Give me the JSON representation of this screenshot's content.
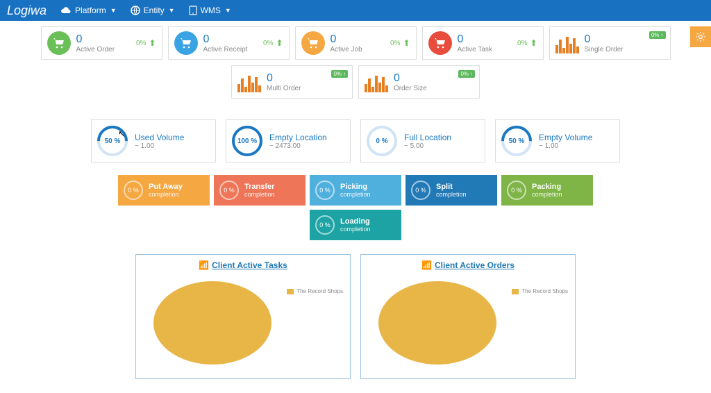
{
  "header": {
    "logo": "Logiwa",
    "nav": [
      {
        "label": "Platform",
        "icon": "cloud-icon"
      },
      {
        "label": "Entity",
        "icon": "globe-icon"
      },
      {
        "label": "WMS",
        "icon": "tablet-icon"
      }
    ]
  },
  "kpi_row1": [
    {
      "value": "0",
      "label": "Active Order",
      "pct": "0%",
      "color": "green",
      "icon": "cart"
    },
    {
      "value": "0",
      "label": "Active Receipt",
      "pct": "0%",
      "color": "blue",
      "icon": "cart"
    },
    {
      "value": "0",
      "label": "Active Job",
      "pct": "0%",
      "color": "orange",
      "icon": "cart"
    },
    {
      "value": "0",
      "label": "Active Task",
      "pct": "0%",
      "color": "red",
      "icon": "cart"
    },
    {
      "value": "0",
      "label": "Single Order",
      "pct": "0%",
      "icon": "bars",
      "badge": true
    }
  ],
  "kpi_row2": [
    {
      "value": "0",
      "label": "Multi Order",
      "pct": "0%",
      "icon": "bars",
      "badge": true
    },
    {
      "value": "0",
      "label": "Order Size",
      "pct": "0%",
      "icon": "bars",
      "badge": true
    }
  ],
  "gauges": [
    {
      "pct": "50 %",
      "title": "Used Volume",
      "sub": "~ 1.00",
      "fill": "half"
    },
    {
      "pct": "100 %",
      "title": "Empty Location",
      "sub": "~ 2473.00",
      "fill": "full"
    },
    {
      "pct": "0 %",
      "title": "Full Location",
      "sub": "~ 5.00",
      "fill": "zero"
    },
    {
      "pct": "50 %",
      "title": "Empty Volume",
      "sub": "~ 1.00",
      "fill": "half"
    }
  ],
  "tiles_row1": [
    {
      "pct": "0 %",
      "title": "Put Away",
      "sub": "completion",
      "cls": "t-orange"
    },
    {
      "pct": "0 %",
      "title": "Transfer",
      "sub": "completion",
      "cls": "t-red"
    },
    {
      "pct": "0 %",
      "title": "Picking",
      "sub": "completion",
      "cls": "t-lblue"
    },
    {
      "pct": "0 %",
      "title": "Split",
      "sub": "completion",
      "cls": "t-blue"
    },
    {
      "pct": "0 %",
      "title": "Packing",
      "sub": "completion",
      "cls": "t-green"
    }
  ],
  "tiles_row2": [
    {
      "pct": "0 %",
      "title": "Loading",
      "sub": "completion",
      "cls": "t-teal"
    }
  ],
  "panels": [
    {
      "title": "Client Active Tasks",
      "legend": "The Record Shops"
    },
    {
      "title": "Client Active Orders",
      "legend": "The Record Shops"
    }
  ],
  "chart_data": [
    {
      "type": "pie",
      "title": "Client Active Tasks",
      "series": [
        {
          "name": "The Record Shops",
          "value": 100
        }
      ]
    },
    {
      "type": "pie",
      "title": "Client Active Orders",
      "series": [
        {
          "name": "The Record Shops",
          "value": 100
        }
      ]
    }
  ]
}
